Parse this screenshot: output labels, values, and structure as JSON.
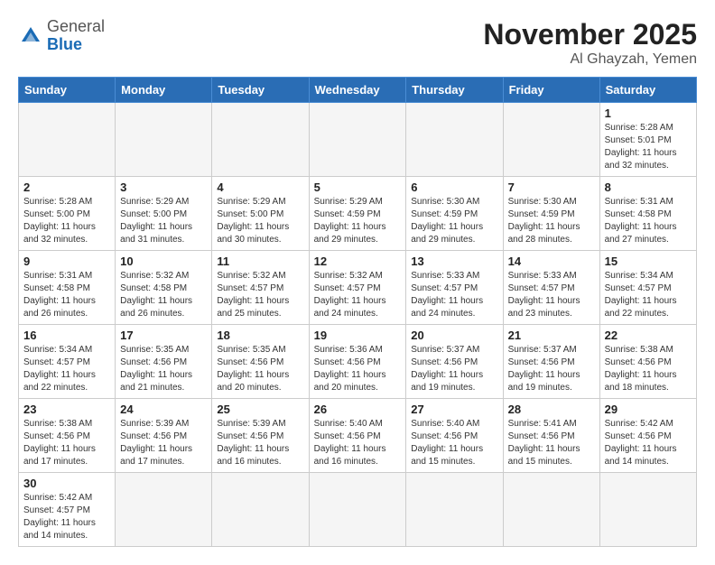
{
  "header": {
    "logo_general": "General",
    "logo_blue": "Blue",
    "month_title": "November 2025",
    "location": "Al Ghayzah, Yemen"
  },
  "weekdays": [
    "Sunday",
    "Monday",
    "Tuesday",
    "Wednesday",
    "Thursday",
    "Friday",
    "Saturday"
  ],
  "weeks": [
    [
      {
        "day": "",
        "info": ""
      },
      {
        "day": "",
        "info": ""
      },
      {
        "day": "",
        "info": ""
      },
      {
        "day": "",
        "info": ""
      },
      {
        "day": "",
        "info": ""
      },
      {
        "day": "",
        "info": ""
      },
      {
        "day": "1",
        "info": "Sunrise: 5:28 AM\nSunset: 5:01 PM\nDaylight: 11 hours and 32 minutes."
      }
    ],
    [
      {
        "day": "2",
        "info": "Sunrise: 5:28 AM\nSunset: 5:00 PM\nDaylight: 11 hours and 32 minutes."
      },
      {
        "day": "3",
        "info": "Sunrise: 5:29 AM\nSunset: 5:00 PM\nDaylight: 11 hours and 31 minutes."
      },
      {
        "day": "4",
        "info": "Sunrise: 5:29 AM\nSunset: 5:00 PM\nDaylight: 11 hours and 30 minutes."
      },
      {
        "day": "5",
        "info": "Sunrise: 5:29 AM\nSunset: 4:59 PM\nDaylight: 11 hours and 29 minutes."
      },
      {
        "day": "6",
        "info": "Sunrise: 5:30 AM\nSunset: 4:59 PM\nDaylight: 11 hours and 29 minutes."
      },
      {
        "day": "7",
        "info": "Sunrise: 5:30 AM\nSunset: 4:59 PM\nDaylight: 11 hours and 28 minutes."
      },
      {
        "day": "8",
        "info": "Sunrise: 5:31 AM\nSunset: 4:58 PM\nDaylight: 11 hours and 27 minutes."
      }
    ],
    [
      {
        "day": "9",
        "info": "Sunrise: 5:31 AM\nSunset: 4:58 PM\nDaylight: 11 hours and 26 minutes."
      },
      {
        "day": "10",
        "info": "Sunrise: 5:32 AM\nSunset: 4:58 PM\nDaylight: 11 hours and 26 minutes."
      },
      {
        "day": "11",
        "info": "Sunrise: 5:32 AM\nSunset: 4:57 PM\nDaylight: 11 hours and 25 minutes."
      },
      {
        "day": "12",
        "info": "Sunrise: 5:32 AM\nSunset: 4:57 PM\nDaylight: 11 hours and 24 minutes."
      },
      {
        "day": "13",
        "info": "Sunrise: 5:33 AM\nSunset: 4:57 PM\nDaylight: 11 hours and 24 minutes."
      },
      {
        "day": "14",
        "info": "Sunrise: 5:33 AM\nSunset: 4:57 PM\nDaylight: 11 hours and 23 minutes."
      },
      {
        "day": "15",
        "info": "Sunrise: 5:34 AM\nSunset: 4:57 PM\nDaylight: 11 hours and 22 minutes."
      }
    ],
    [
      {
        "day": "16",
        "info": "Sunrise: 5:34 AM\nSunset: 4:57 PM\nDaylight: 11 hours and 22 minutes."
      },
      {
        "day": "17",
        "info": "Sunrise: 5:35 AM\nSunset: 4:56 PM\nDaylight: 11 hours and 21 minutes."
      },
      {
        "day": "18",
        "info": "Sunrise: 5:35 AM\nSunset: 4:56 PM\nDaylight: 11 hours and 20 minutes."
      },
      {
        "day": "19",
        "info": "Sunrise: 5:36 AM\nSunset: 4:56 PM\nDaylight: 11 hours and 20 minutes."
      },
      {
        "day": "20",
        "info": "Sunrise: 5:37 AM\nSunset: 4:56 PM\nDaylight: 11 hours and 19 minutes."
      },
      {
        "day": "21",
        "info": "Sunrise: 5:37 AM\nSunset: 4:56 PM\nDaylight: 11 hours and 19 minutes."
      },
      {
        "day": "22",
        "info": "Sunrise: 5:38 AM\nSunset: 4:56 PM\nDaylight: 11 hours and 18 minutes."
      }
    ],
    [
      {
        "day": "23",
        "info": "Sunrise: 5:38 AM\nSunset: 4:56 PM\nDaylight: 11 hours and 17 minutes."
      },
      {
        "day": "24",
        "info": "Sunrise: 5:39 AM\nSunset: 4:56 PM\nDaylight: 11 hours and 17 minutes."
      },
      {
        "day": "25",
        "info": "Sunrise: 5:39 AM\nSunset: 4:56 PM\nDaylight: 11 hours and 16 minutes."
      },
      {
        "day": "26",
        "info": "Sunrise: 5:40 AM\nSunset: 4:56 PM\nDaylight: 11 hours and 16 minutes."
      },
      {
        "day": "27",
        "info": "Sunrise: 5:40 AM\nSunset: 4:56 PM\nDaylight: 11 hours and 15 minutes."
      },
      {
        "day": "28",
        "info": "Sunrise: 5:41 AM\nSunset: 4:56 PM\nDaylight: 11 hours and 15 minutes."
      },
      {
        "day": "29",
        "info": "Sunrise: 5:42 AM\nSunset: 4:56 PM\nDaylight: 11 hours and 14 minutes."
      }
    ],
    [
      {
        "day": "30",
        "info": "Sunrise: 5:42 AM\nSunset: 4:57 PM\nDaylight: 11 hours and 14 minutes."
      },
      {
        "day": "",
        "info": ""
      },
      {
        "day": "",
        "info": ""
      },
      {
        "day": "",
        "info": ""
      },
      {
        "day": "",
        "info": ""
      },
      {
        "day": "",
        "info": ""
      },
      {
        "day": "",
        "info": ""
      }
    ]
  ]
}
